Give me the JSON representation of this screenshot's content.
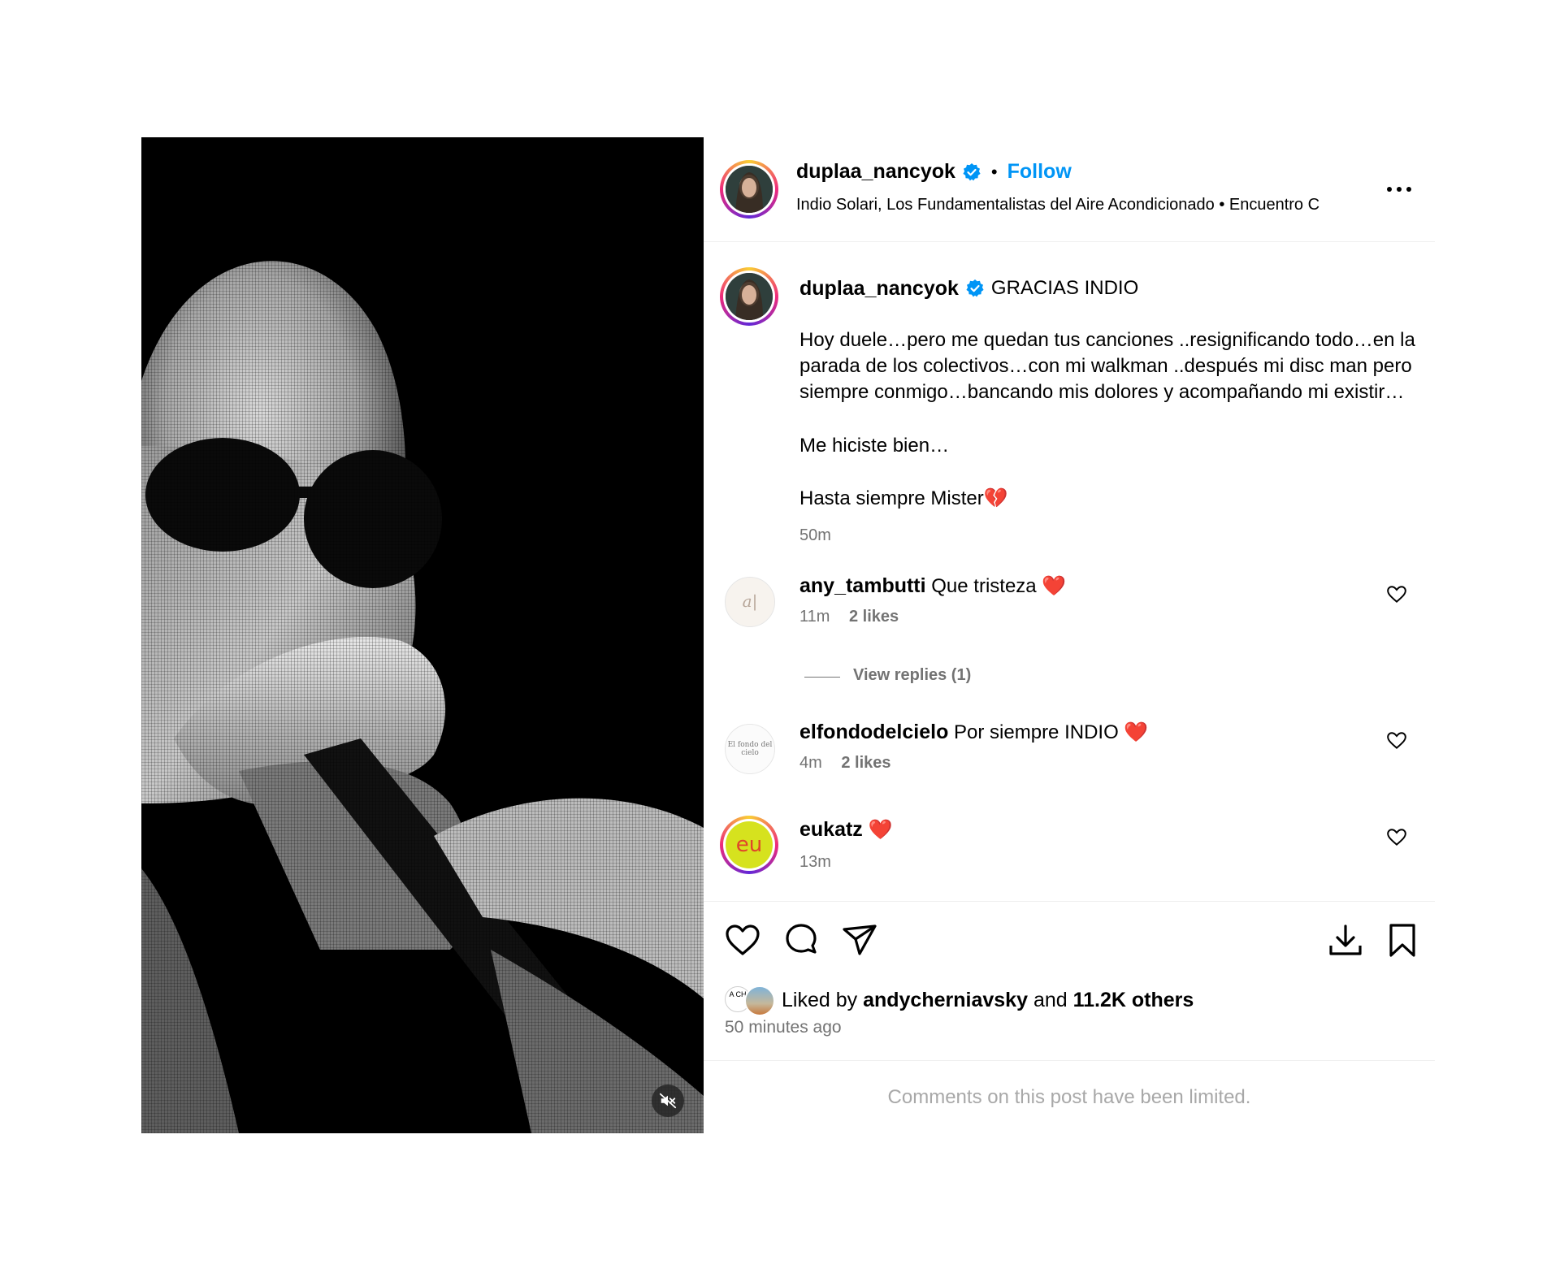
{
  "post": {
    "author": "duplaa_nancyok",
    "follow_label": "Follow",
    "separator": "•",
    "audio_line": "Indio Solari, Los Fundamentalistas del Aire Acondicionado • Encuentro C",
    "caption_title": "GRACIAS INDIO",
    "caption_paragraphs": [
      "Hoy duele…pero me quedan tus canciones ..resignificando todo…en la parada de los colectivos…con mi walkman ..después mi disc man pero siempre conmigo…bancando mis dolores y acompañando mi existir…",
      "Me hiciste bien…",
      "Hasta siempre Mister💔"
    ],
    "caption_time": "50m"
  },
  "comments": [
    {
      "user": "any_tambutti",
      "text": "Que tristeza",
      "emoji": "❤️",
      "time": "11m",
      "likes": "2 likes",
      "avatar_text": "a|"
    },
    {
      "user": "elfondodelcielo",
      "text": "Por siempre INDIO",
      "emoji": "❤️",
      "time": "4m",
      "likes": "2 likes",
      "avatar_text": "El fondo del cielo"
    },
    {
      "user": "eukatz",
      "text": "",
      "emoji": "❤️",
      "time": "13m",
      "likes": "",
      "avatar_text": "eu"
    }
  ],
  "view_replies": "View replies (1)",
  "likes": {
    "prefix": "Liked by",
    "user": "andycherniavsky",
    "conj": "and",
    "others": "11.2K others",
    "avatar_text": "A CH"
  },
  "posted_ago": "50 minutes ago",
  "limited_notice": "Comments on this post have been limited.",
  "icons": {
    "like": "heart-icon",
    "comment": "comment-icon",
    "share": "send-icon",
    "download": "download-icon",
    "save": "bookmark-icon",
    "mute": "muted-speaker-icon",
    "more": "more-options-icon"
  },
  "colors": {
    "follow": "#0095f6",
    "muted_text": "#737373",
    "verified": "#0095f6",
    "heart": "#e0153a"
  }
}
